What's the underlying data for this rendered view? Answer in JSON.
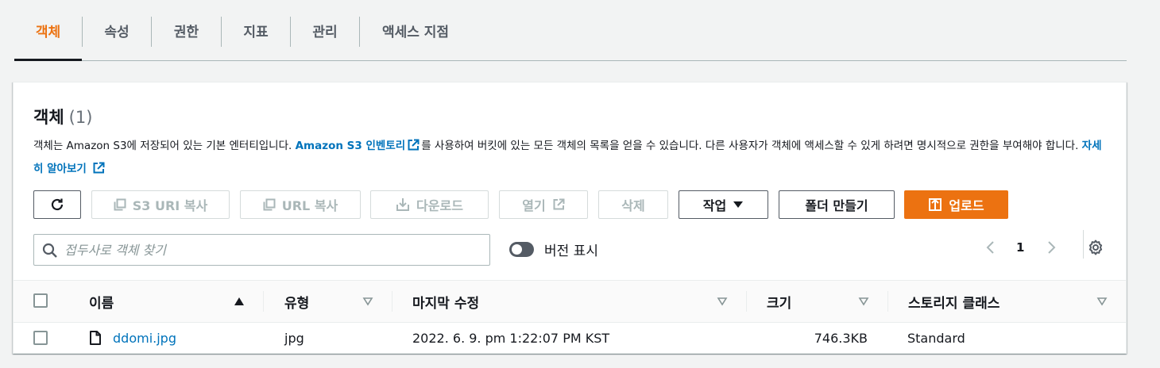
{
  "tabs": [
    {
      "label": "객체",
      "active": true
    },
    {
      "label": "속성"
    },
    {
      "label": "권한"
    },
    {
      "label": "지표"
    },
    {
      "label": "관리"
    },
    {
      "label": "액세스 지점"
    }
  ],
  "panel": {
    "title": "객체",
    "count": "(1)",
    "description": {
      "part1": "객체는 Amazon S3에 저장되어 있는 기본 엔터티입니다. ",
      "link1": "Amazon S3 인벤토리",
      "part2": "를 사용하여 버킷에 있는 모든 객체의 목록을 얻을 수 있습니다. 다른 사용자가 객체에 액세스할 수 있게 하려면 명시적으로 권한을 부여해야 합니다. ",
      "link2": "자세히 알아보기"
    }
  },
  "toolbar": {
    "copy_s3_uri": "S3 URI 복사",
    "copy_url": "URL 복사",
    "download": "다운로드",
    "open": "열기",
    "delete": "삭제",
    "actions": "작업",
    "create_folder": "폴더 만들기",
    "upload": "업로드"
  },
  "search": {
    "placeholder": "접두사로 객체 찾기"
  },
  "versions_toggle": {
    "label": "버전 표시",
    "on": false
  },
  "pagination": {
    "current_page": "1"
  },
  "table": {
    "columns": [
      "이름",
      "유형",
      "마지막 수정",
      "크기",
      "스토리지 클래스"
    ],
    "rows": [
      {
        "name": "ddomi.jpg",
        "type": "jpg",
        "last_modified": "2022. 6. 9. pm 1:22:07 PM KST",
        "size": "746.3KB",
        "storage_class": "Standard"
      }
    ]
  },
  "colors": {
    "accent": "#ec7211",
    "link": "#0073bb",
    "text": "#16191f",
    "disabled": "#aab7b8"
  }
}
